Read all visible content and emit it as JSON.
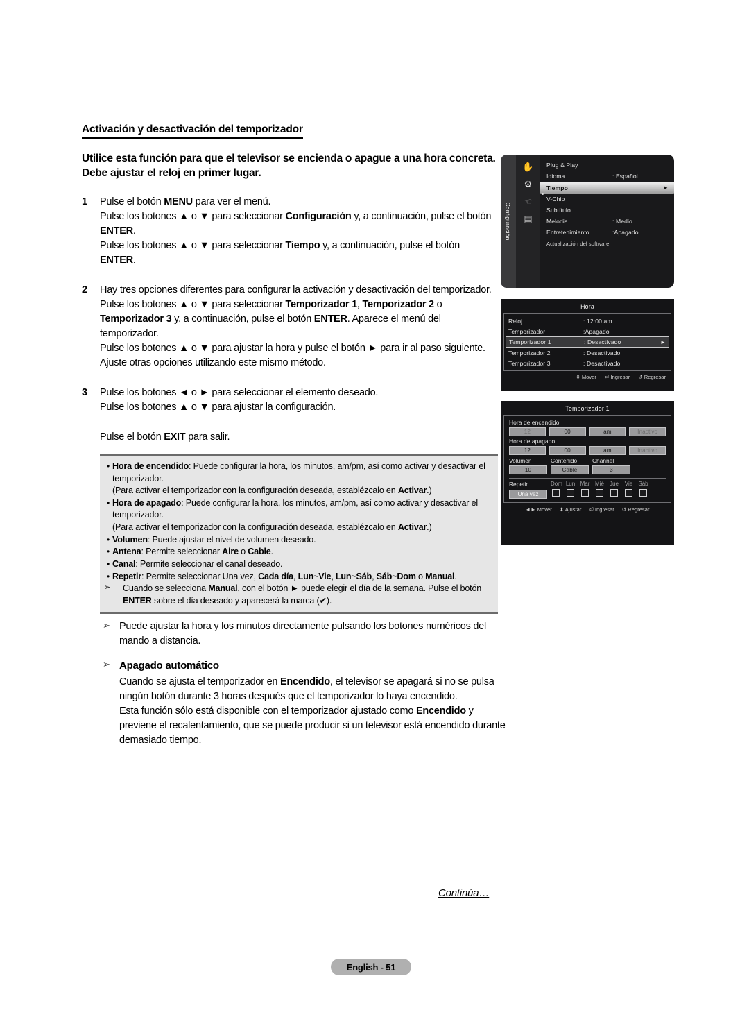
{
  "document": {
    "section_title": "Activación y desactivación del temporizador",
    "lede": "Utilice esta función para que el televisor se encienda o apague a una hora concreta. Debe ajustar el reloj en primer lugar.",
    "steps": [
      {
        "num": "1",
        "lines": [
          "Pulse el botón <b>MENU</b> para ver el menú.",
          "Pulse los botones ▲ o ▼ para seleccionar <b>Configuración</b> y, a continuación, pulse el botón <b>ENTER</b>.",
          "Pulse los botones ▲ o ▼ para seleccionar <b>Tiempo</b> y, a continuación, pulse el botón <b>ENTER</b>."
        ]
      },
      {
        "num": "2",
        "lines": [
          "Hay tres opciones diferentes para configurar la activación y desactivación del temporizador.",
          "Pulse los botones ▲ o ▼ para seleccionar <b>Temporizador 1</b>, <b>Temporizador 2</b> o <b>Temporizador 3</b> y, a continuación, pulse el botón <b>ENTER</b>. Aparece el menú del temporizador.",
          "Pulse los botones ▲ o ▼ para ajustar la hora y pulse el botón ► para ir al paso siguiente. Ajuste otras opciones utilizando este mismo método."
        ]
      },
      {
        "num": "3",
        "lines": [
          "Pulse los botones ◄ o ► para seleccionar el elemento deseado.",
          "Pulse los botones ▲ o ▼ para ajustar la configuración."
        ]
      }
    ],
    "exit_line": "Pulse el botón <b>EXIT</b> para salir.",
    "infobox": [
      {
        "type": "bullet",
        "text": "<b>Hora de encendido</b>: Puede configurar la hora, los minutos, am/pm, así como activar y desactivar el temporizador."
      },
      {
        "type": "plain",
        "text": "(Para activar el temporizador con la configuración deseada, establézcalo en <b>Activar</b>.)"
      },
      {
        "type": "bullet",
        "text": "<b>Hora de apagado</b>: Puede configurar la hora, los minutos, am/pm, así como activar y desactivar el temporizador."
      },
      {
        "type": "plain",
        "text": "(Para activar el temporizador con la configuración deseada, establézcalo en <b>Activar</b>.)"
      },
      {
        "type": "bullet",
        "text": "<b>Volumen</b>: Puede ajustar el nivel de volumen deseado."
      },
      {
        "type": "bullet",
        "text": "<b>Antena</b>: Permite seleccionar <b>Aire</b> o <b>Cable</b>."
      },
      {
        "type": "bullet",
        "text": "<b>Canal</b>: Permite seleccionar el canal deseado."
      },
      {
        "type": "bullet",
        "text": "<b>Repetir</b>: Permite seleccionar Una vez, <b>Cada día</b>, <b>Lun~Vie</b>, <b>Lun~Sáb</b>, <b>Sáb~Dom</b> o <b>Manual</b>."
      },
      {
        "type": "arrow",
        "text": "Cuando se selecciona <b>Manual</b>, con el botón ► puede elegir el día de la semana. Pulse el botón <b>ENTER</b> sobre el día deseado y aparecerá la marca (✔)."
      }
    ],
    "notes": [
      {
        "head": "",
        "body": "Puede ajustar la hora y los minutos directamente pulsando los botones numéricos del mando a distancia."
      },
      {
        "head": "Apagado automático",
        "body": "Cuando se ajusta el temporizador en <b>Encendido</b>, el televisor se apagará si no se pulsa ningún botón durante 3 horas después que el temporizador lo haya encendido.<br>Esta función sólo está disponible con el temporizador ajustado como <b>Encendido</b> y previene el recalentamiento, que se puede producir si un televisor está encendido durante demasiado tiempo."
      }
    ],
    "continua": "Continúa…",
    "page_label": "English - 51"
  },
  "menu_setup": {
    "rail_label": "Configuración",
    "icons": [
      "picture-icon",
      "settings-gear-icon",
      "input-icon",
      "screen-icon"
    ],
    "selected_icon_index": 1,
    "items": [
      {
        "label": "Plug & Play",
        "value": "",
        "selected": false,
        "small": false
      },
      {
        "label": "Idioma",
        "value": ": Español",
        "selected": false,
        "small": false
      },
      {
        "label": "Tiempo",
        "value": "",
        "selected": true,
        "small": false,
        "arrow": "►"
      },
      {
        "label": "V-Chip",
        "value": "",
        "selected": false,
        "small": false
      },
      {
        "label": "Subtítulo",
        "value": "",
        "selected": false,
        "small": false
      },
      {
        "label": "Melodia",
        "value": ": Medio",
        "selected": false,
        "small": false
      },
      {
        "label": "Entretenimiento",
        "value": ":Apagado",
        "selected": false,
        "small": false
      },
      {
        "label": "Actualización del software",
        "value": "",
        "selected": false,
        "small": true
      }
    ]
  },
  "menu_hora": {
    "title": "Hora",
    "rows": [
      {
        "label": "Reloj",
        "value": ": 12:00 am",
        "selected": false
      },
      {
        "label": "Temporizador",
        "value": ":Apagado",
        "selected": false
      },
      {
        "label": "Temporizador 1",
        "value": ": Desactivado",
        "selected": true,
        "arrow": "►"
      },
      {
        "label": "Temporizador 2",
        "value": ": Desactivado",
        "selected": false
      },
      {
        "label": "Temporizador 3",
        "value": ": Desactivado",
        "selected": false
      }
    ],
    "hints": [
      {
        "icon": "⬍",
        "label": "Mover"
      },
      {
        "icon": "⏎",
        "label": "Ingresar"
      },
      {
        "icon": "↺",
        "label": "Regresar"
      }
    ]
  },
  "menu_timer1": {
    "title": "Temporizador 1",
    "on_time_caption": "Hora de encendido",
    "on_time_fields": [
      {
        "value": "12",
        "dim": true
      },
      {
        "value": "00",
        "dim": false
      },
      {
        "value": "am",
        "dim": false
      },
      {
        "value": "Inactivo",
        "dim": true
      }
    ],
    "off_time_caption": "Hora de apagado",
    "off_time_fields": [
      {
        "value": "12",
        "dim": false
      },
      {
        "value": "00",
        "dim": false
      },
      {
        "value": "am",
        "dim": false
      },
      {
        "value": "Inactivo",
        "dim": true
      }
    ],
    "col_headers": [
      "Volumen",
      "Contenido",
      "Channel"
    ],
    "col_values": [
      "10",
      "Cable",
      "3"
    ],
    "repeat_label": "Repetir",
    "repeat_value": "Una vez",
    "days": [
      "Dom",
      "Lun",
      "Mar",
      "Mié",
      "Jue",
      "Vie",
      "Sáb"
    ],
    "days_checked": [
      false,
      false,
      false,
      false,
      false,
      false,
      false
    ],
    "hints": [
      {
        "icon": "◄►",
        "label": "Mover"
      },
      {
        "icon": "⬍",
        "label": "Ajustar"
      },
      {
        "icon": "⏎",
        "label": "Ingresar"
      },
      {
        "icon": "↺",
        "label": "Regresar"
      }
    ]
  },
  "colors": {
    "infobox_bg": "#e6e6e6",
    "menu_bg": "#141416",
    "menu_field": "#9a9a9c",
    "page_pill": "#b0b0b0"
  }
}
